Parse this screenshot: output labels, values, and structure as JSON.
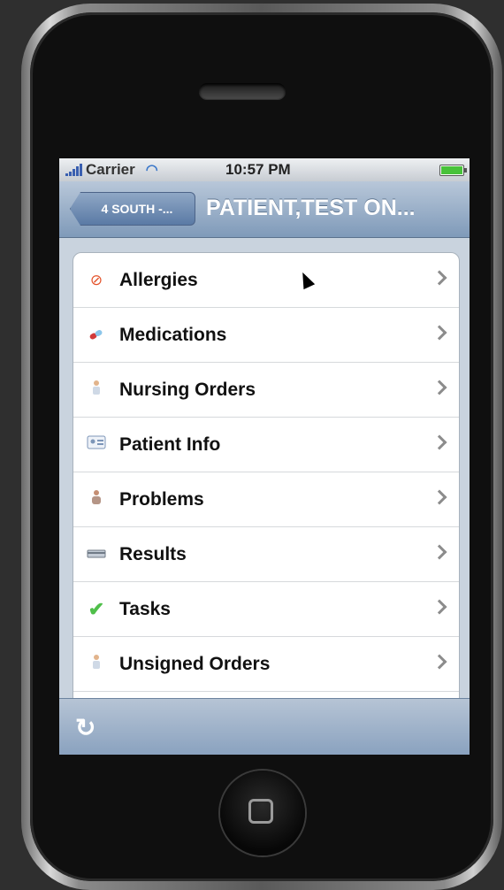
{
  "statusbar": {
    "carrier": "Carrier",
    "time": "10:57 PM",
    "battery_level": 1.0
  },
  "navbar": {
    "back_label": "4 SOUTH -...",
    "title": "PATIENT,TEST ON..."
  },
  "menu": {
    "items": [
      {
        "label": "Allergies",
        "icon": "no-entry-icon"
      },
      {
        "label": "Medications",
        "icon": "pill-icon"
      },
      {
        "label": "Nursing Orders",
        "icon": "nurse-icon"
      },
      {
        "label": "Patient Info",
        "icon": "id-card-icon"
      },
      {
        "label": "Problems",
        "icon": "person-icon"
      },
      {
        "label": "Results",
        "icon": "results-icon"
      },
      {
        "label": "Tasks",
        "icon": "checkmark-icon"
      },
      {
        "label": "Unsigned Orders",
        "icon": "nurse-icon"
      }
    ]
  },
  "toolbar": {
    "refresh_icon": "refresh-icon"
  },
  "colors": {
    "nav_accent": "#7f9ab9",
    "check_green": "#4fbf4a",
    "allergy_red": "#e4532b"
  }
}
